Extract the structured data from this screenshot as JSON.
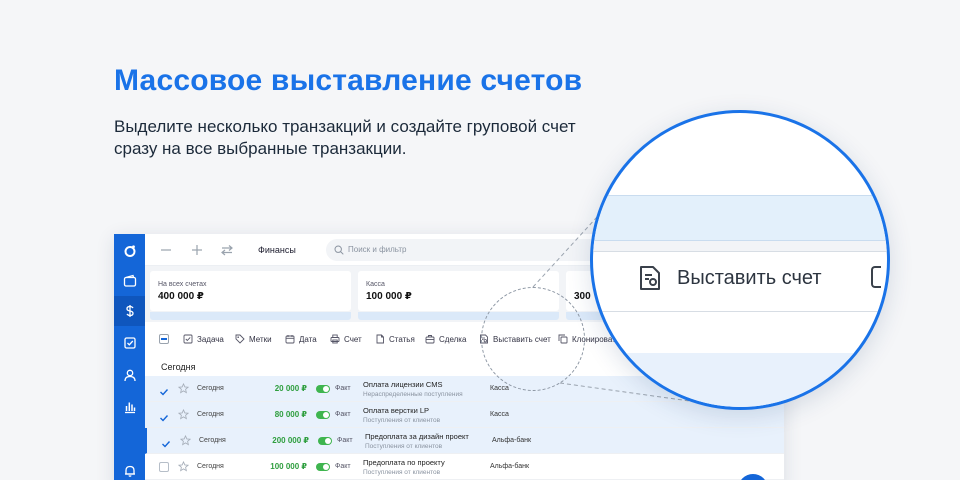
{
  "hero": {
    "title": "Массовое выставление счетов",
    "subtitle": "Выделите несколько транзакций и создайте груповой счет сразу на все выбранные транзакции."
  },
  "colors": {
    "accent": "#1a73e8",
    "rail": "#1466d8",
    "positive": "#2e9e3e"
  },
  "sidebar": {
    "items": [
      {
        "icon": "logo-icon"
      },
      {
        "icon": "wallet-icon"
      },
      {
        "icon": "dollar-icon"
      },
      {
        "icon": "task-check-icon"
      },
      {
        "icon": "user-icon"
      },
      {
        "icon": "bar-chart-icon"
      },
      {
        "icon": "bell-icon"
      }
    ]
  },
  "topbar": {
    "title": "Финансы",
    "search_placeholder": "Поиск и фильтр",
    "icons": [
      "minus-icon",
      "plus-icon",
      "transfer-icon"
    ]
  },
  "cards": [
    {
      "label": "На всех счетах",
      "value": "400 000 ₽"
    },
    {
      "label": "Касса",
      "value": "100 000 ₽"
    },
    {
      "label": "",
      "value": "300"
    }
  ],
  "toolbar": {
    "items": [
      {
        "label": "Задача",
        "icon": "task-check-icon"
      },
      {
        "label": "Метки",
        "icon": "tag-icon"
      },
      {
        "label": "Дата",
        "icon": "calendar-icon"
      },
      {
        "label": "Счет",
        "icon": "printer-icon"
      },
      {
        "label": "Статья",
        "icon": "document-icon"
      },
      {
        "label": "Сделка",
        "icon": "briefcase-icon"
      },
      {
        "label": "Выставить счет",
        "icon": "invoice-icon"
      },
      {
        "label": "Клонировать",
        "icon": "copy-icon"
      }
    ]
  },
  "list": {
    "section": "Сегодня",
    "rows": [
      {
        "checked": true,
        "date": "Сегодня",
        "amount": "20 000 ₽",
        "status": "Факт",
        "title": "Оплата лицензии CMS",
        "category": "Нераспределенные поступления",
        "account": "Касса"
      },
      {
        "checked": true,
        "date": "Сегодня",
        "amount": "80 000 ₽",
        "status": "Факт",
        "title": "Оплата верстки LP",
        "category": "Поступления от клиентов",
        "account": "Касса"
      },
      {
        "checked": true,
        "date": "Сегодня",
        "amount": "200 000 ₽",
        "status": "Факт",
        "title": "Предоплата за дизайн проект",
        "category": "Поступления от клиентов",
        "account": "Альфа-банк"
      },
      {
        "checked": false,
        "date": "Сегодня",
        "amount": "100 000 ₽",
        "status": "Факт",
        "title": "Предоплата по проекту",
        "category": "Поступления от клиентов",
        "account": "Альфа-банк"
      }
    ]
  },
  "magnifier": {
    "button_label": "Выставить счет",
    "icon": "invoice-icon"
  }
}
